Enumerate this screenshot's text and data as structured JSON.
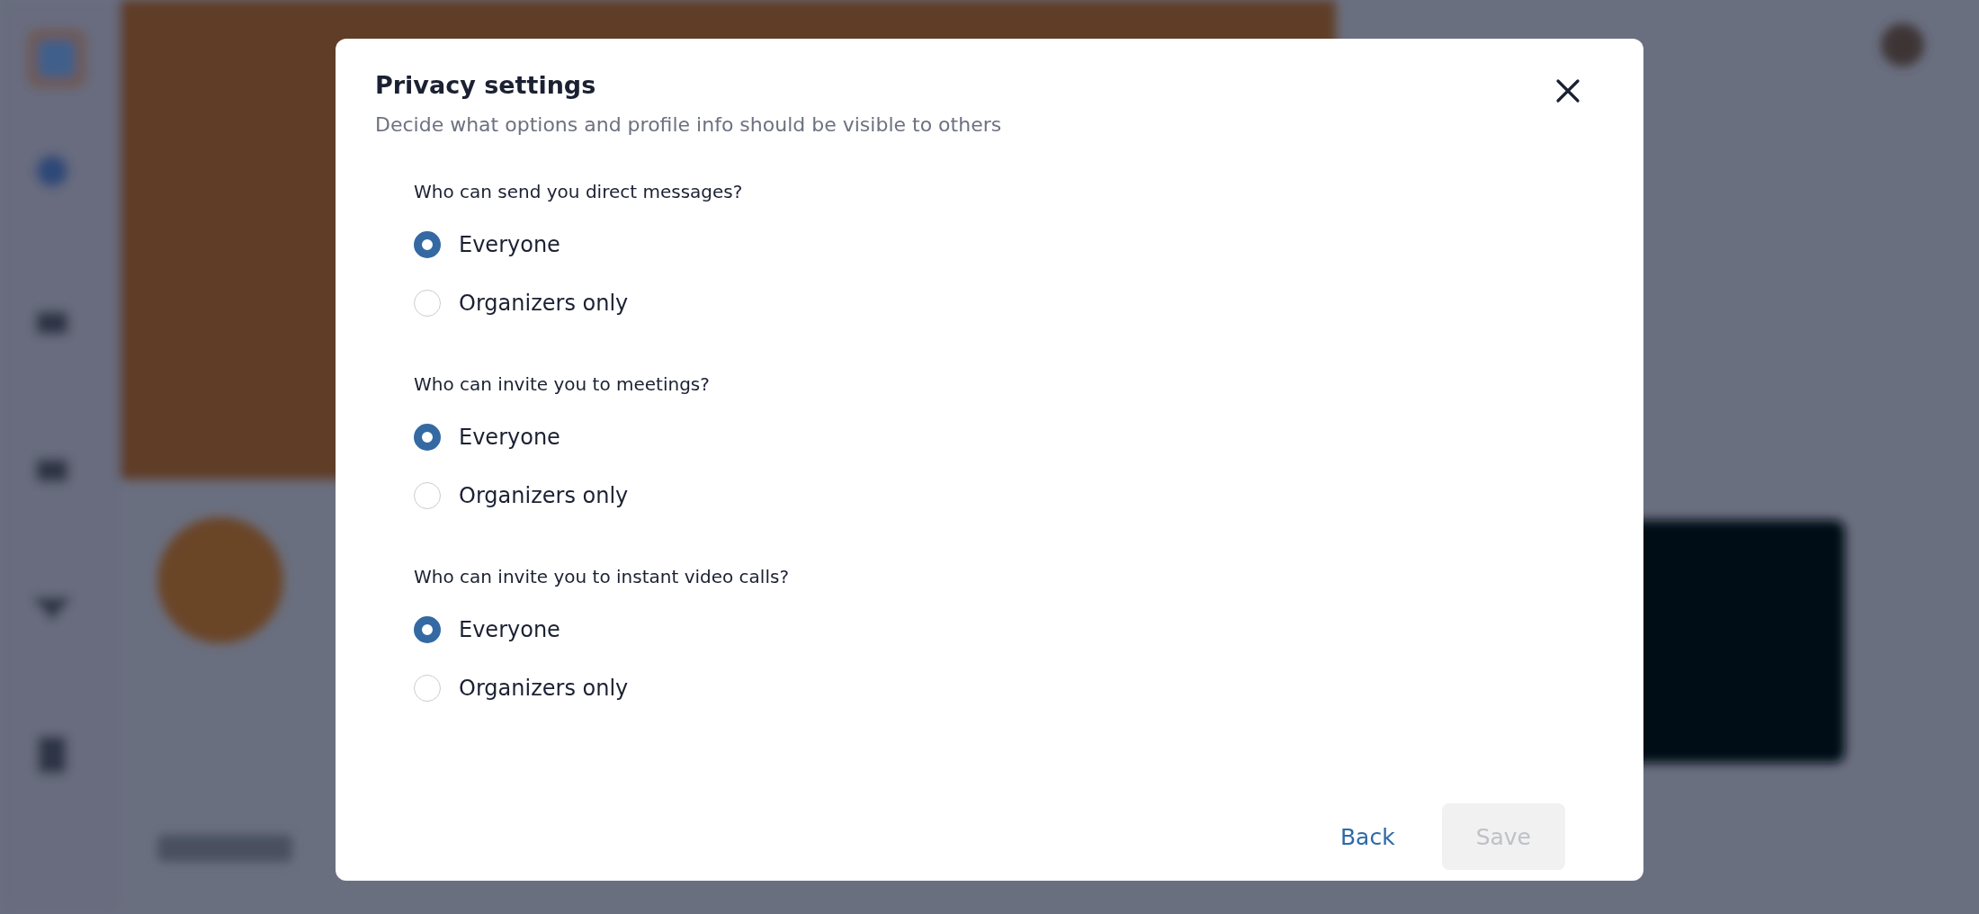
{
  "dialog": {
    "title": "Privacy settings",
    "subtitle": "Decide what options and profile info should be visible to others",
    "questions": [
      {
        "label": "Who can send you direct messages?",
        "options": [
          {
            "label": "Everyone",
            "selected": true
          },
          {
            "label": "Organizers only",
            "selected": false
          }
        ]
      },
      {
        "label": "Who can invite you to meetings?",
        "options": [
          {
            "label": "Everyone",
            "selected": true
          },
          {
            "label": "Organizers only",
            "selected": false
          }
        ]
      },
      {
        "label": "Who can invite you to instant video calls?",
        "options": [
          {
            "label": "Everyone",
            "selected": true
          },
          {
            "label": "Organizers only",
            "selected": false
          }
        ]
      }
    ],
    "buttons": [
      {
        "label": "Back",
        "kind": "link",
        "disabled": false
      },
      {
        "label": "Save",
        "kind": "primary",
        "disabled": true
      }
    ]
  }
}
